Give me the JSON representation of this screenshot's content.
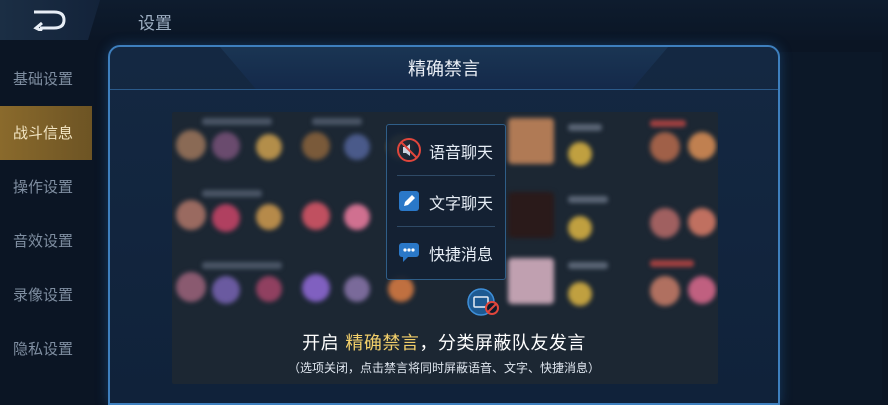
{
  "topbar": {
    "title": "设置"
  },
  "sidebar": {
    "items": [
      {
        "label": "基础设置",
        "active": false
      },
      {
        "label": "战斗信息",
        "active": true
      },
      {
        "label": "操作设置",
        "active": false
      },
      {
        "label": "音效设置",
        "active": false
      },
      {
        "label": "录像设置",
        "active": false
      },
      {
        "label": "隐私设置",
        "active": false
      }
    ]
  },
  "dialog": {
    "title": "精确禁言",
    "popup": {
      "items": [
        {
          "label": "语音聊天",
          "icon": "speaker-muted-icon"
        },
        {
          "label": "文字聊天",
          "icon": "pencil-icon"
        },
        {
          "label": "快捷消息",
          "icon": "chat-bubble-icon"
        }
      ]
    },
    "caption": {
      "prefix": "开启",
      "highlight": "精确禁言",
      "suffix": "，分类屏蔽队友发言"
    },
    "subcaption": "（选项关闭，点击禁言将同时屏蔽语音、文字、快捷消息）"
  },
  "colors": {
    "accent": "#3e7fbd",
    "active_tab": "#8a6a2c",
    "highlight": "#f2cf6a",
    "mute_red": "#e0463c"
  }
}
